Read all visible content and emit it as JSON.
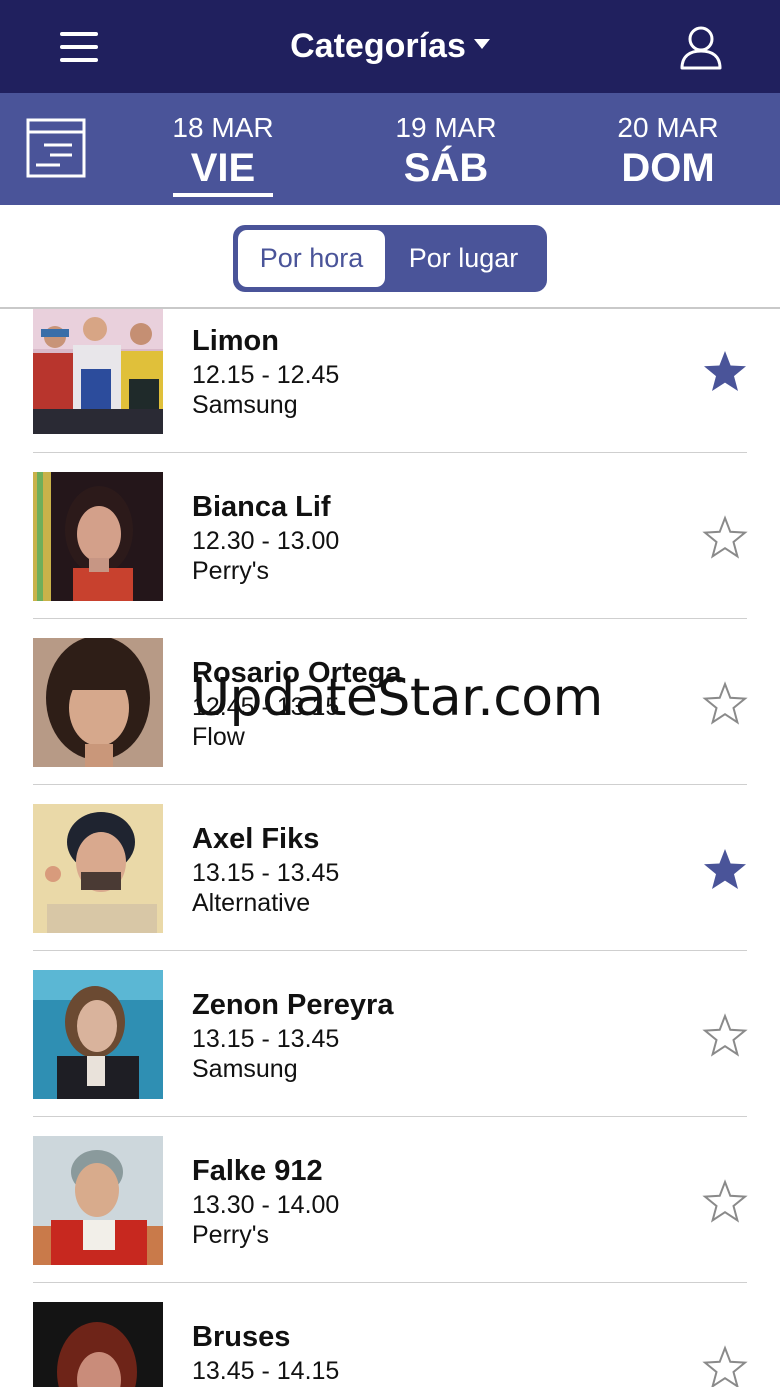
{
  "header": {
    "title": "Categorías",
    "menu_icon": "hamburger-menu-icon",
    "user_icon": "user-profile-icon",
    "bar_color": "#20205e"
  },
  "datebar": {
    "filter_icon": "filter-list-icon",
    "bar_color": "#4a5499",
    "days": [
      {
        "date": "18 MAR",
        "name": "VIE",
        "active": true
      },
      {
        "date": "19 MAR",
        "name": "SÁB",
        "active": false
      },
      {
        "date": "20 MAR",
        "name": "DOM",
        "active": false
      }
    ]
  },
  "view_toggle": {
    "by_hour": "Por hora",
    "by_place": "Por lugar",
    "selected": "Por hora"
  },
  "artists": [
    {
      "name": "Limon",
      "time": "12.15 - 12.45",
      "stage": "Samsung",
      "favorite": true
    },
    {
      "name": "Bianca Lif",
      "time": "12.30 - 13.00",
      "stage": "Perry's",
      "favorite": false
    },
    {
      "name": "Rosario Ortega",
      "time": "12.45 - 13.15",
      "stage": "Flow",
      "favorite": false
    },
    {
      "name": "Axel Fiks",
      "time": "13.15 - 13.45",
      "stage": "Alternative",
      "favorite": true
    },
    {
      "name": "Zenon Pereyra",
      "time": "13.15 - 13.45",
      "stage": "Samsung",
      "favorite": false
    },
    {
      "name": "Falke 912",
      "time": "13.30 - 14.00",
      "stage": "Perry's",
      "favorite": false
    },
    {
      "name": "Bruses",
      "time": "13.45 - 14.15",
      "stage": "",
      "favorite": false
    }
  ],
  "star_color": "#4a5499",
  "watermark": "UpdateStar.com"
}
